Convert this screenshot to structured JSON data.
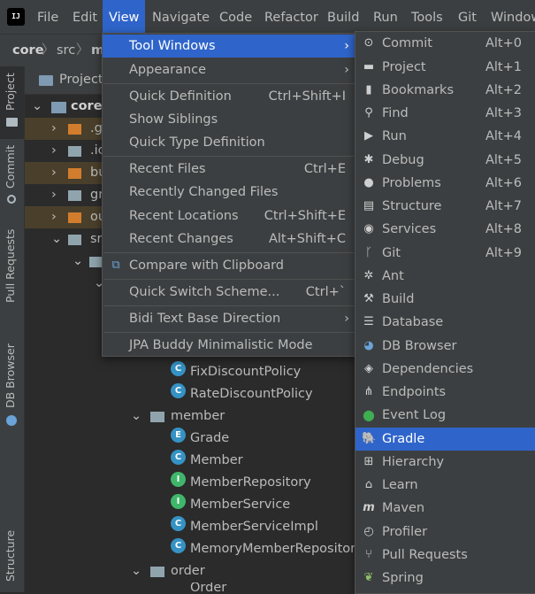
{
  "menubar": {
    "items": [
      "File",
      "Edit",
      "View",
      "Navigate",
      "Code",
      "Refactor",
      "Build",
      "Run",
      "Tools",
      "Git",
      "Window"
    ],
    "active": "View"
  },
  "navbar": {
    "crumbs": [
      "core",
      "src",
      "m"
    ]
  },
  "stripe": {
    "tabs": [
      "Project",
      "Commit",
      "Pull Requests",
      "DB Browser",
      "Structure"
    ]
  },
  "project": {
    "title": "Project",
    "rows": [
      {
        "label": "core",
        "bold": true
      },
      {
        "label": ".g"
      },
      {
        "label": ".ic"
      },
      {
        "label": "bu"
      },
      {
        "label": "gr"
      },
      {
        "label": "ou"
      },
      {
        "label": "sr"
      },
      {
        "label": ""
      },
      {
        "label": ""
      },
      {
        "label": "FixDiscountPolicy",
        "icon": "C"
      },
      {
        "label": "RateDiscountPolicy",
        "icon": "C"
      },
      {
        "label": "member"
      },
      {
        "label": "Grade",
        "icon": "E"
      },
      {
        "label": "Member",
        "icon": "C"
      },
      {
        "label": "MemberRepository",
        "icon": "I"
      },
      {
        "label": "MemberService",
        "icon": "I"
      },
      {
        "label": "MemberServiceImpl",
        "icon": "C"
      },
      {
        "label": "MemoryMemberRepository",
        "icon": "C"
      },
      {
        "label": "order"
      },
      {
        "label": "Order",
        "icon": "C"
      }
    ]
  },
  "view_menu": {
    "items": [
      {
        "label": "Tool Windows",
        "shortcut": "",
        "submenu": true
      },
      {
        "label": "Appearance",
        "shortcut": "",
        "submenu": true
      },
      {
        "label": "Quick Definition",
        "shortcut": "Ctrl+Shift+I"
      },
      {
        "label": "Show Siblings",
        "shortcut": ""
      },
      {
        "label": "Quick Type Definition",
        "shortcut": ""
      },
      {
        "label": "Recent Files",
        "shortcut": "Ctrl+E"
      },
      {
        "label": "Recently Changed Files",
        "shortcut": ""
      },
      {
        "label": "Recent Locations",
        "shortcut": "Ctrl+Shift+E"
      },
      {
        "label": "Recent Changes",
        "shortcut": "Alt+Shift+C"
      },
      {
        "label": "Compare with Clipboard",
        "shortcut": ""
      },
      {
        "label": "Quick Switch Scheme...",
        "shortcut": "Ctrl+`"
      },
      {
        "label": "Bidi Text Base Direction",
        "shortcut": "",
        "submenu": true
      },
      {
        "label": "JPA Buddy Minimalistic Mode",
        "shortcut": ""
      }
    ]
  },
  "tool_windows_menu": {
    "items": [
      {
        "label": "Commit",
        "shortcut": "Alt+0",
        "icon": "commit-icon"
      },
      {
        "label": "Project",
        "shortcut": "Alt+1",
        "icon": "folder-icon"
      },
      {
        "label": "Bookmarks",
        "shortcut": "Alt+2",
        "icon": "bookmark-icon"
      },
      {
        "label": "Find",
        "shortcut": "Alt+3",
        "icon": "search-icon"
      },
      {
        "label": "Run",
        "shortcut": "Alt+4",
        "icon": "run-icon"
      },
      {
        "label": "Debug",
        "shortcut": "Alt+5",
        "icon": "bug-icon"
      },
      {
        "label": "Problems",
        "shortcut": "Alt+6",
        "icon": "problems-icon"
      },
      {
        "label": "Structure",
        "shortcut": "Alt+7",
        "icon": "structure-icon"
      },
      {
        "label": "Services",
        "shortcut": "Alt+8",
        "icon": "services-icon"
      },
      {
        "label": "Git",
        "shortcut": "Alt+9",
        "icon": "git-icon"
      },
      {
        "label": "Ant",
        "shortcut": "",
        "icon": "ant-icon"
      },
      {
        "label": "Build",
        "shortcut": "",
        "icon": "hammer-icon"
      },
      {
        "label": "Database",
        "shortcut": "",
        "icon": "database-icon"
      },
      {
        "label": "DB Browser",
        "shortcut": "",
        "icon": "db-browser-icon"
      },
      {
        "label": "Dependencies",
        "shortcut": "",
        "icon": "dependencies-icon"
      },
      {
        "label": "Endpoints",
        "shortcut": "",
        "icon": "endpoints-icon"
      },
      {
        "label": "Event Log",
        "shortcut": "",
        "icon": "event-log-icon"
      },
      {
        "label": "Gradle",
        "shortcut": "",
        "icon": "gradle-icon",
        "selected": true
      },
      {
        "label": "Hierarchy",
        "shortcut": "",
        "icon": "hierarchy-icon"
      },
      {
        "label": "Learn",
        "shortcut": "",
        "icon": "learn-icon"
      },
      {
        "label": "Maven",
        "shortcut": "",
        "icon": "maven-icon"
      },
      {
        "label": "Profiler",
        "shortcut": "",
        "icon": "profiler-icon"
      },
      {
        "label": "Pull Requests",
        "shortcut": "",
        "icon": "pull-requests-icon"
      },
      {
        "label": "Spring",
        "shortcut": "",
        "icon": "spring-icon"
      }
    ]
  },
  "colors": {
    "accent": "#2f65ca",
    "menu_bg": "#3c3f41",
    "editor_bg": "#2b2b2b",
    "text": "#bbbbbb"
  }
}
